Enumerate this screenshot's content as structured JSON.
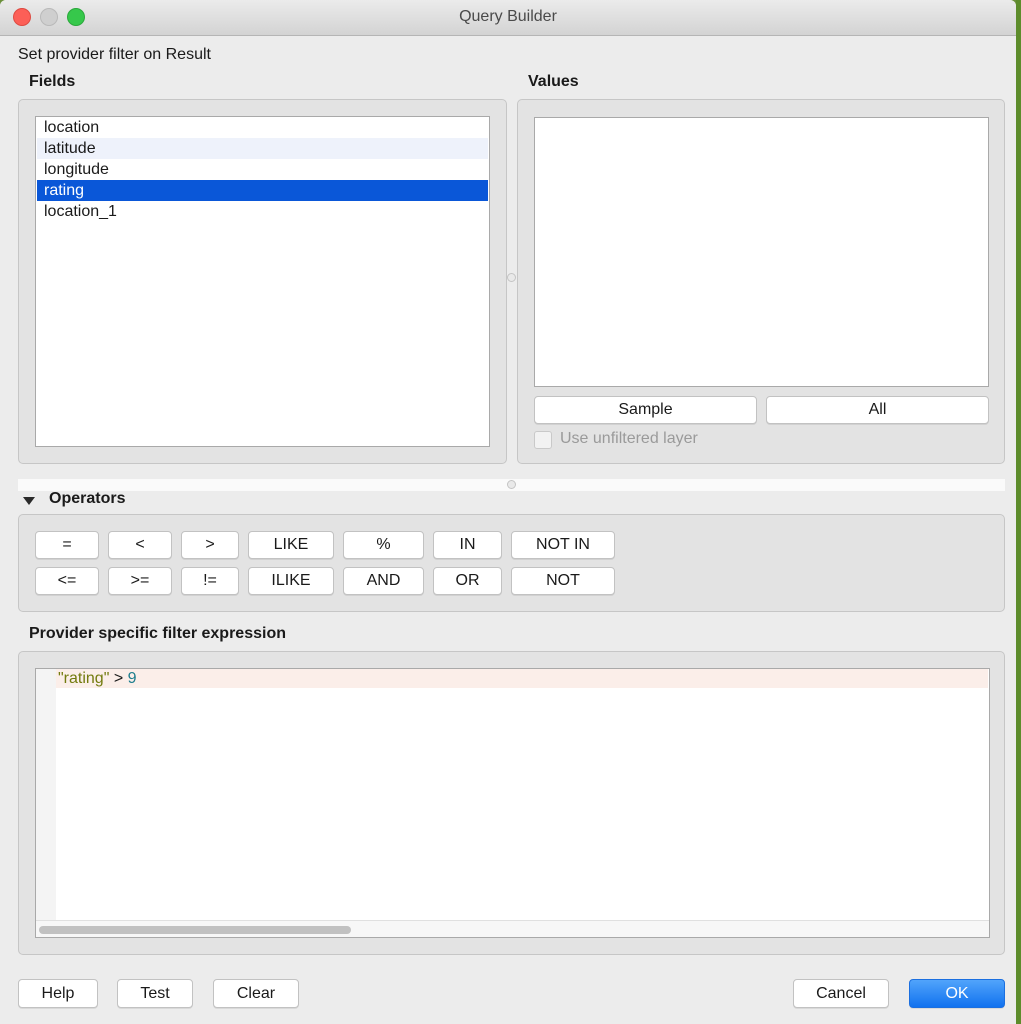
{
  "window": {
    "title": "Query Builder"
  },
  "header": {
    "caption": "Set provider filter on Result"
  },
  "fields": {
    "label": "Fields",
    "items": [
      "location",
      "latitude",
      "longitude",
      "rating",
      "location_1"
    ],
    "selected": "rating"
  },
  "values": {
    "label": "Values",
    "sample_label": "Sample",
    "all_label": "All",
    "unfiltered_label": "Use unfiltered layer",
    "unfiltered_checked": false
  },
  "operators": {
    "label": "Operators",
    "row1": [
      "=",
      "<",
      ">",
      "LIKE",
      "%",
      "IN",
      "NOT IN"
    ],
    "row2": [
      "<=",
      ">=",
      "!=",
      "ILIKE",
      "AND",
      "OR",
      "NOT"
    ]
  },
  "expression": {
    "label": "Provider specific filter expression",
    "tokens": {
      "field": "\"rating\"",
      "op": " > ",
      "value": "9"
    }
  },
  "footer": {
    "help_label": "Help",
    "test_label": "Test",
    "clear_label": "Clear",
    "cancel_label": "Cancel",
    "ok_label": "OK"
  },
  "colors": {
    "selection": "#0a57d8",
    "primary_button": "#1172ef",
    "close": "#fc5f57",
    "maximize": "#36c84b"
  }
}
